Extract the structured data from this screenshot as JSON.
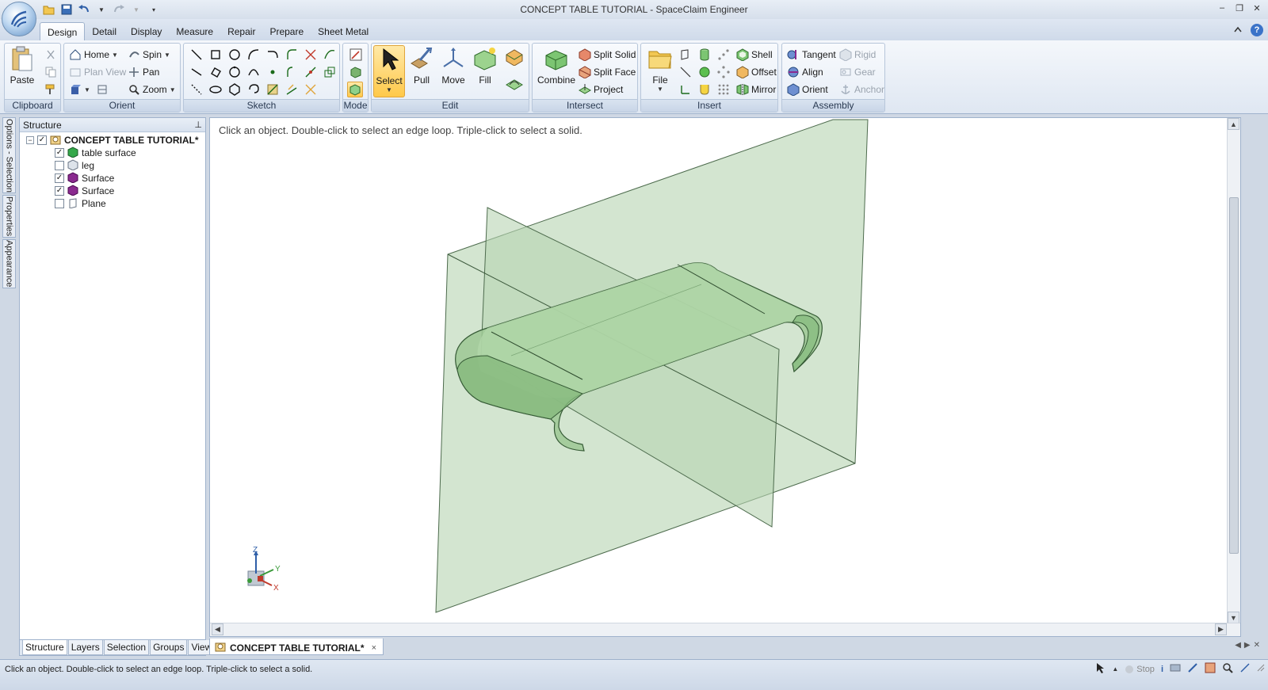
{
  "window": {
    "title": "CONCEPT TABLE TUTORIAL - SpaceClaim Engineer",
    "minimize": "‒",
    "restore": "❐",
    "close": "✕"
  },
  "ribbon_tabs": [
    "Design",
    "Detail",
    "Display",
    "Measure",
    "Repair",
    "Prepare",
    "Sheet Metal"
  ],
  "active_tab": "Design",
  "help_label": "?",
  "groups": {
    "clipboard": {
      "label": "Clipboard",
      "paste": "Paste"
    },
    "orient": {
      "label": "Orient",
      "home": "Home",
      "spin": "Spin",
      "plan_view": "Plan View",
      "pan": "Pan",
      "zoom": "Zoom"
    },
    "sketch": {
      "label": "Sketch"
    },
    "mode": {
      "label": "Mode"
    },
    "edit": {
      "label": "Edit",
      "select": "Select",
      "pull": "Pull",
      "move": "Move",
      "fill": "Fill"
    },
    "intersect": {
      "label": "Intersect",
      "combine": "Combine",
      "split_solid": "Split Solid",
      "split_face": "Split Face",
      "project": "Project"
    },
    "insert": {
      "label": "Insert",
      "file": "File",
      "shell": "Shell",
      "offset": "Offset",
      "mirror": "Mirror"
    },
    "assembly": {
      "label": "Assembly",
      "tangent": "Tangent",
      "align": "Align",
      "orient": "Orient",
      "rigid": "Rigid",
      "gear": "Gear",
      "anchor": "Anchor"
    }
  },
  "side_tabs": [
    "Options - Selection",
    "Properties",
    "Appearance"
  ],
  "structure": {
    "title": "Structure",
    "pin": "⊥",
    "root": {
      "label": "CONCEPT TABLE TUTORIAL*",
      "checked": true,
      "expander": "−"
    },
    "items": [
      {
        "label": "table surface",
        "checked": true,
        "icon": "solid-body-icon",
        "color": "#35a84a"
      },
      {
        "label": "leg",
        "checked": false,
        "icon": "solid-body-icon",
        "color": "#8a8f96"
      },
      {
        "label": "Surface",
        "checked": true,
        "icon": "surface-body-icon",
        "color": "#8a2a8f"
      },
      {
        "label": "Surface",
        "checked": true,
        "icon": "surface-body-icon",
        "color": "#8a2a8f"
      },
      {
        "label": "Plane",
        "checked": false,
        "icon": "plane-icon",
        "color": "#8a8f96"
      }
    ],
    "tabs": [
      "Structure",
      "Layers",
      "Selection",
      "Groups",
      "Views"
    ],
    "active_tab": "Structure"
  },
  "viewport": {
    "hint": "Click an object. Double-click to select an edge loop. Triple-click to select a solid.",
    "axis_labels": {
      "z": "Z",
      "y": "Y",
      "x": "X"
    },
    "model_color": "#a7c7a2"
  },
  "document_tab": {
    "label": "CONCEPT TABLE TUTORIAL*",
    "close": "×"
  },
  "status": {
    "text": "Click an object. Double-click to select an edge loop. Triple-click to select a solid.",
    "stop": "Stop"
  }
}
